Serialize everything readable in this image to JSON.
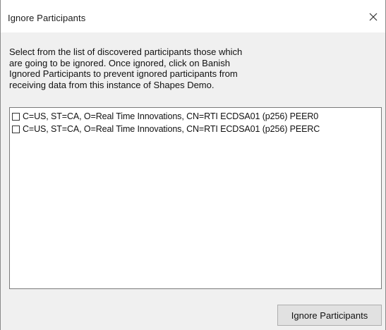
{
  "window": {
    "title": "Ignore Participants"
  },
  "instructions": {
    "lines": [
      "Select from the list of discovered participants those which",
      "are going to be ignored. Once ignored, click on Banish",
      "Ignored Participants to prevent ignored participants from",
      "receiving data from this instance of Shapes Demo."
    ]
  },
  "participants": [
    {
      "label": "C=US, ST=CA, O=Real Time Innovations, CN=RTI ECDSA01 (p256) PEER0",
      "checked": false
    },
    {
      "label": "C=US, ST=CA, O=Real Time Innovations, CN=RTI ECDSA01 (p256) PEERC",
      "checked": false
    }
  ],
  "buttons": {
    "ignore_label": "Ignore Participants"
  },
  "icons": {
    "close": "close-icon",
    "checkbox": "checkbox-icon"
  },
  "colors": {
    "dialog_background": "#f0f0f0",
    "titlebar_background": "#ffffff",
    "button_background": "#e1e1e1",
    "list_border": "#7a7a7a"
  }
}
